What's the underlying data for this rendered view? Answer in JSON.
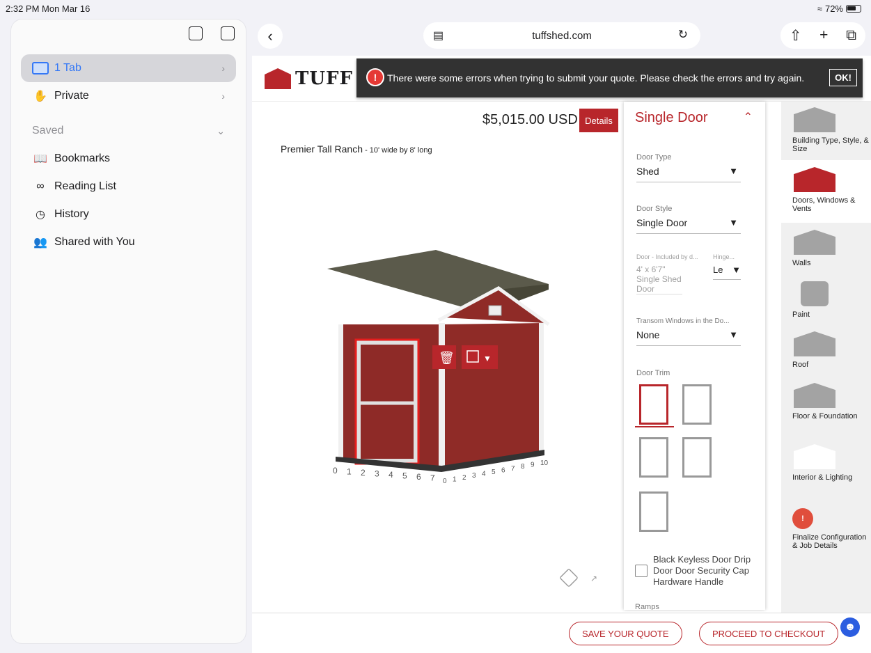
{
  "status": {
    "time": "2:32 PM  Mon Mar 16",
    "battery": "72%"
  },
  "sidebar": {
    "items": [
      {
        "label": "1 Tab"
      },
      {
        "label": "Private"
      },
      {
        "label": "Saved"
      },
      {
        "label": "Bookmarks"
      },
      {
        "label": "Reading List"
      },
      {
        "label": "History"
      },
      {
        "label": "Shared with You"
      }
    ]
  },
  "browser": {
    "url": "tuffshed.com"
  },
  "site": {
    "logo_text": "TUFF SI",
    "error_message": "There were some errors when trying to submit your quote. Please check the errors and try again.",
    "ok_label": "OK!",
    "price": "$5,015.00 USD",
    "details_label": "Details",
    "product_name": "Premier Tall Ranch",
    "product_size": " - 10' wide by 8' long"
  },
  "config": {
    "title": "Single Door",
    "door_type_label": "Door Type",
    "door_type_value": "Shed",
    "door_style_label": "Door Style",
    "door_style_value": "Single Door",
    "door_included_label": "Door - Included by d...",
    "hinge_label": "Hinge...",
    "door_included_value": "4' x 6'7\" Single Shed Door",
    "hinge_value": "Le",
    "transom_label": "Transom Windows in the Do...",
    "transom_value": "None",
    "door_trim_label": "Door Trim",
    "hardware_labels": "Black Keyless Door Drip Door Door Security Cap Hardware Handle",
    "ramps_label": "Ramps"
  },
  "nav_rail": [
    {
      "label": "Building Type, Style, & Size"
    },
    {
      "label": "Doors, Windows & Vents"
    },
    {
      "label": "Walls"
    },
    {
      "label": "Paint"
    },
    {
      "label": "Roof"
    },
    {
      "label": "Floor & Foundation"
    },
    {
      "label": "Interior & Lighting"
    },
    {
      "label": "Finalize Configuration & Job Details"
    }
  ],
  "bottom": {
    "save_label": "SAVE YOUR QUOTE",
    "checkout_label": "PROCEED TO CHECKOUT"
  },
  "ruler": {
    "front": [
      "0",
      "1",
      "2",
      "3",
      "4",
      "5",
      "6",
      "7"
    ],
    "side": [
      "0",
      "1",
      "2",
      "3",
      "4",
      "5",
      "6",
      "7",
      "8",
      "9",
      "10"
    ]
  },
  "colors": {
    "brand_red": "#b8262b",
    "error_bg": "#323232",
    "accent_blue": "#3478f6"
  }
}
